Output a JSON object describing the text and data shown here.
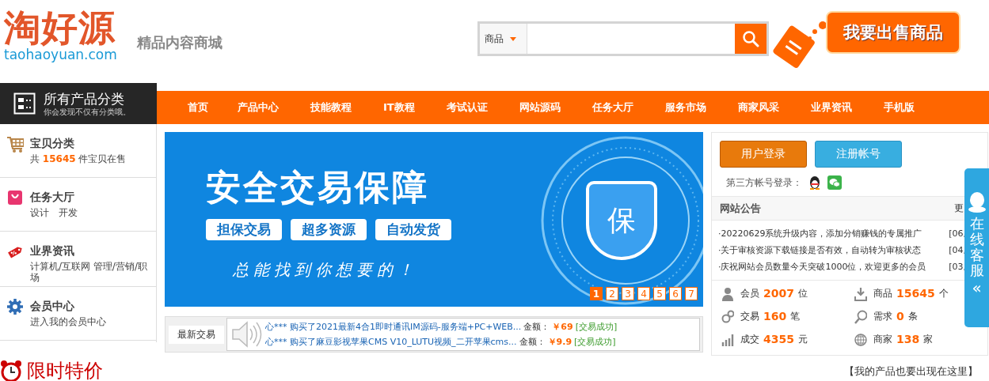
{
  "header": {
    "logo": "淘好源",
    "domain": "taohaoyuan.com",
    "slogan": "精品内容商城",
    "search": {
      "scope": "商品"
    },
    "sell_button": "我要出售商品"
  },
  "category_menu": {
    "title": "所有产品分类",
    "subtitle": "你会发现不仅有分类哦。"
  },
  "nav": [
    {
      "label": "首页",
      "selected": false
    },
    {
      "label": "产品中心",
      "selected": false
    },
    {
      "label": "技能教程",
      "selected": false
    },
    {
      "label": "IT教程",
      "selected": false
    },
    {
      "label": "考试认证",
      "selected": false
    },
    {
      "label": "网站源码",
      "selected": false
    },
    {
      "label": "任务大厅",
      "selected": false
    },
    {
      "label": "服务市场",
      "selected": false
    },
    {
      "label": "商家风采",
      "selected": false
    },
    {
      "label": "业界资讯",
      "selected": false
    },
    {
      "label": "手机版",
      "selected": false
    }
  ],
  "sidebar": [
    {
      "kind": "cart",
      "title": "宝贝分类",
      "sub": "共 **15645** 件宝贝在售"
    },
    {
      "kind": "bag",
      "title": "任务大厅",
      "sub": "设计　开发"
    },
    {
      "kind": "tag",
      "title": "业界资讯",
      "sub": "计算机/互联网 管理/营销/职场"
    },
    {
      "kind": "gear",
      "title": "会员中心",
      "sub": "进入我的会员中心"
    }
  ],
  "banner": {
    "title": "安全交易保障",
    "tags": [
      "担保交易",
      "超多资源",
      "自动发货"
    ],
    "tagline": "总能找到你想要的！",
    "shield": "保",
    "pages": [
      {
        "label": "1",
        "selected": true
      },
      {
        "label": "2",
        "selected": false
      },
      {
        "label": "3",
        "selected": false
      },
      {
        "label": "4",
        "selected": false
      },
      {
        "label": "5",
        "selected": false
      },
      {
        "label": "6",
        "selected": false
      },
      {
        "label": "7",
        "selected": false
      }
    ]
  },
  "ticker": {
    "label": "最新交易",
    "items": [
      {
        "text": "心*** 购买了2021最新4合1即时通讯IM源码-服务端+PC+WEB...",
        "amount_label": "金额：",
        "amount": "￥69",
        "status": "[交易成功]"
      },
      {
        "text": "心*** 购买了麻豆影视苹果CMS V10_LUTU视频_二开苹果cms...",
        "amount_label": "金额：",
        "amount": "￥9.9",
        "status": "[交易成功]"
      }
    ]
  },
  "account": {
    "login": "用户登录",
    "register": "注册帐号",
    "third_party": "第三方帐号登录："
  },
  "notices": {
    "title": "网站公告",
    "more": "更",
    "items": [
      {
        "text": "·20220629系统升级内容，添加分销赚钱的专属推广",
        "date": "[06,"
      },
      {
        "text": "·关于审核资源下载链接是否有效，自动转为审核状态",
        "date": "[04,"
      },
      {
        "text": "·庆祝网站会员数量今天突破1000位，欢迎更多的会员",
        "date": "[03,"
      }
    ]
  },
  "stats": [
    {
      "kind": "member",
      "label": "会员",
      "value": "2007",
      "unit": "位"
    },
    {
      "kind": "download",
      "label": "商品",
      "value": "15645",
      "unit": "个"
    },
    {
      "kind": "gears",
      "label": "交易",
      "value": "160",
      "unit": "笔"
    },
    {
      "kind": "search",
      "label": "需求",
      "value": "0",
      "unit": "条"
    },
    {
      "kind": "chart",
      "label": "成交",
      "value": "4355",
      "unit": "元"
    },
    {
      "kind": "globe",
      "label": "商家",
      "value": "138",
      "unit": "家"
    }
  ],
  "service_tab": {
    "label": "在线客服",
    "arrow": "«"
  },
  "bottom": {
    "section_title": "限时特价",
    "promo_link": "【我的产品也要出现在这里】"
  }
}
